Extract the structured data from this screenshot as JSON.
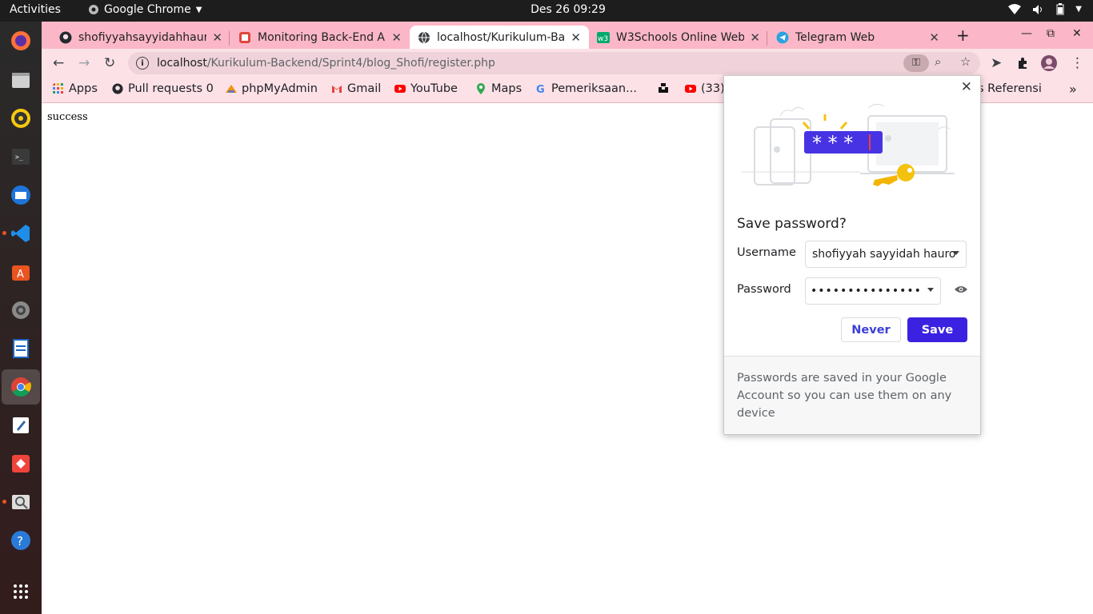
{
  "topbar": {
    "activities": "Activities",
    "app_name": "Google Chrome",
    "clock": "Des 26  09:29"
  },
  "tabs": [
    {
      "title": "shofiyyahsayyidahhauro",
      "icon": "github-icon"
    },
    {
      "title": "Monitoring Back-End A",
      "icon": "monitoring-icon"
    },
    {
      "title": "localhost/Kurikulum-Ba",
      "icon": "globe-icon"
    },
    {
      "title": "W3Schools Online Web",
      "icon": "w3schools-icon"
    },
    {
      "title": "Telegram Web",
      "icon": "telegram-icon"
    }
  ],
  "toolbar": {
    "url_host": "localhost",
    "url_path": "/Kurikulum-Backend/Sprint4/blog_Shofi/register.php"
  },
  "bookmarks": [
    {
      "label": "Apps",
      "icon": "apps-grid-icon"
    },
    {
      "label": "Pull requests 0",
      "icon": "github-icon"
    },
    {
      "label": "phpMyAdmin",
      "icon": "phpmyadmin-icon"
    },
    {
      "label": "Gmail",
      "icon": "gmail-icon"
    },
    {
      "label": "YouTube",
      "icon": "youtube-icon"
    },
    {
      "label": "Maps",
      "icon": "maps-icon"
    },
    {
      "label": "Pemeriksaan...",
      "icon": "google-icon"
    },
    {
      "label": "",
      "icon": "unsplash-icon"
    },
    {
      "label": "(33)",
      "icon": "youtube-icon"
    },
    {
      "label": "s Referensi",
      "icon": ""
    }
  ],
  "page": {
    "text": "success"
  },
  "save_password": {
    "title": "Save password?",
    "username_label": "Username",
    "username_value": "shofiyyah sayyidah hauro",
    "password_label": "Password",
    "password_value": "•••••••••••••••",
    "never_label": "Never",
    "save_label": "Save",
    "footer": "Passwords are saved in your Google Account so you can use them on any device"
  },
  "colors": {
    "tabstrip": "#fbb7c7",
    "toolbar": "#fce1e7",
    "accent": "#3b22e0"
  }
}
